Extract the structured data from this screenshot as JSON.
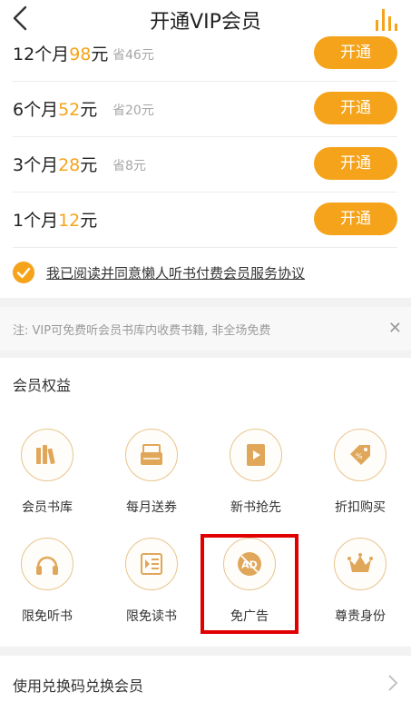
{
  "header": {
    "title": "开通VIP会员",
    "back_icon": "chevron-left-icon",
    "stats_icon": "bar-chart-icon"
  },
  "plans": [
    {
      "duration": "12个月",
      "price": "98",
      "unit": "元",
      "save": "省46元",
      "button": "开通"
    },
    {
      "duration": "6个月",
      "price": "52",
      "unit": "元",
      "save": "省20元",
      "button": "开通"
    },
    {
      "duration": "3个月",
      "price": "28",
      "unit": "元",
      "save": "省8元",
      "button": "开通"
    },
    {
      "duration": "1个月",
      "price": "12",
      "unit": "元",
      "save": "",
      "button": "开通"
    }
  ],
  "agreement": {
    "text": "我已阅读并同意懒人听书付费会员服务协议",
    "checked": true
  },
  "notice": {
    "text": "注: VIP可免费听会员书库内收费书籍, 非全场免费",
    "close_icon": "close-icon"
  },
  "benefits": {
    "title": "会员权益",
    "items": [
      {
        "label": "会员书库",
        "icon": "books-icon"
      },
      {
        "label": "每月送券",
        "icon": "coupon-box-icon"
      },
      {
        "label": "新书抢先",
        "icon": "book-play-icon"
      },
      {
        "label": "折扣购买",
        "icon": "discount-tag-icon"
      },
      {
        "label": "限免听书",
        "icon": "headphones-icon"
      },
      {
        "label": "限免读书",
        "icon": "reading-icon"
      },
      {
        "label": "免广告",
        "icon": "no-ad-icon",
        "ad_text": "AD"
      },
      {
        "label": "尊贵身份",
        "icon": "crown-icon"
      }
    ]
  },
  "redeem": {
    "text": "使用兑换码兑换会员",
    "arrow_icon": "chevron-right-icon"
  },
  "colors": {
    "accent": "#f5a31a",
    "icon_gold": "#e0a75a",
    "highlight": "#e00000"
  }
}
